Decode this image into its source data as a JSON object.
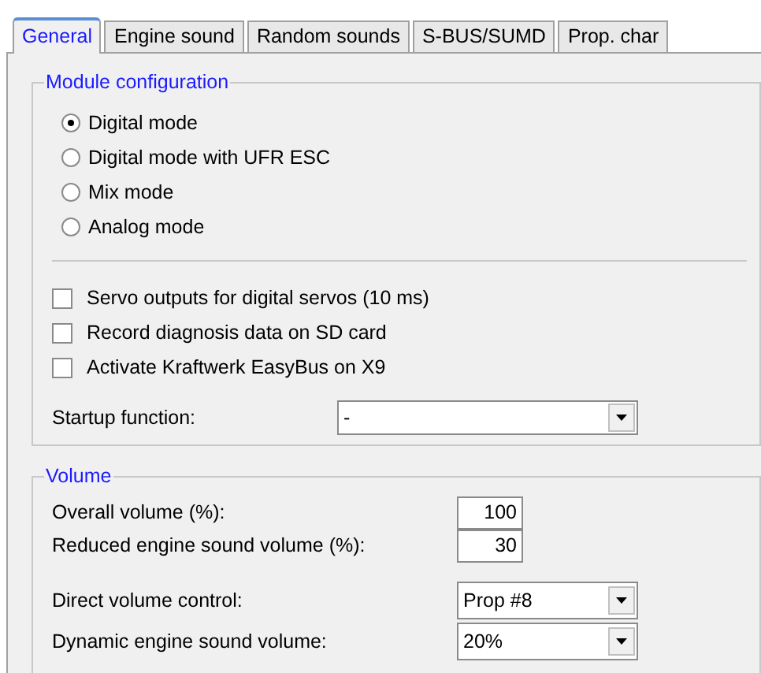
{
  "tabs": [
    {
      "label": "General",
      "selected": true
    },
    {
      "label": "Engine sound",
      "selected": false
    },
    {
      "label": "Random sounds",
      "selected": false
    },
    {
      "label": "S-BUS/SUMD",
      "selected": false
    },
    {
      "label": "Prop. char",
      "selected": false
    }
  ],
  "module_configuration": {
    "title": "Module configuration",
    "modes": [
      {
        "label": "Digital mode",
        "selected": true
      },
      {
        "label": "Digital mode with UFR ESC",
        "selected": false
      },
      {
        "label": "Mix mode",
        "selected": false
      },
      {
        "label": "Analog mode",
        "selected": false
      }
    ],
    "options": [
      {
        "label": "Servo outputs for digital servos (10 ms)",
        "checked": false
      },
      {
        "label": "Record diagnosis data on SD card",
        "checked": false
      },
      {
        "label": "Activate Kraftwerk EasyBus on X9",
        "checked": false
      }
    ],
    "startup_function": {
      "label": "Startup function:",
      "value": "-"
    }
  },
  "volume": {
    "title": "Volume",
    "fields": [
      {
        "label": "Overall volume (%):",
        "value": "100"
      },
      {
        "label": "Reduced engine sound volume (%):",
        "value": "30"
      }
    ],
    "dropdowns": [
      {
        "label": "Direct volume control:",
        "value": "Prop #8"
      },
      {
        "label": "Dynamic engine sound volume:",
        "value": "20%"
      }
    ]
  }
}
